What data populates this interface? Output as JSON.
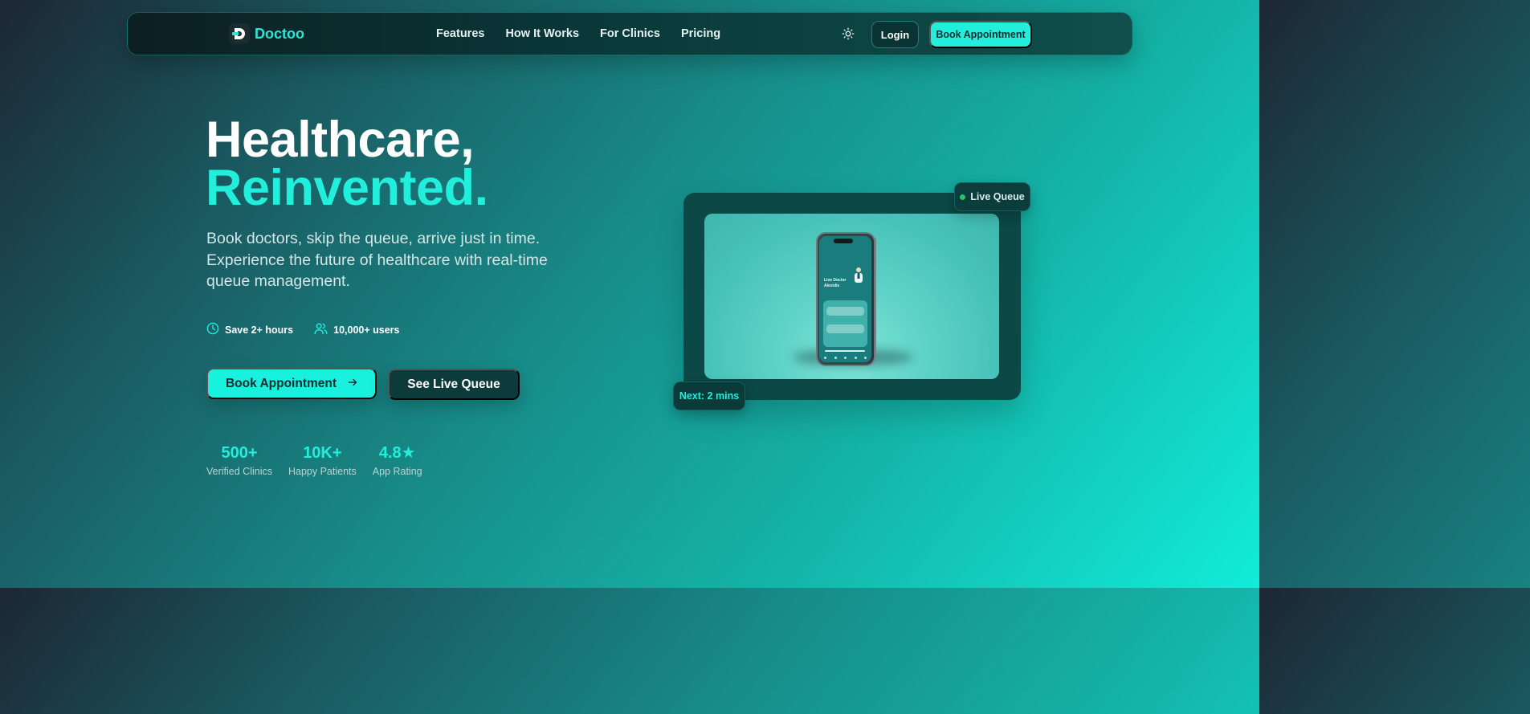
{
  "colors": {
    "accent": "#22eedc",
    "nav_bg": "#0a3a3a",
    "card_bg": "#0b4846",
    "live_dot": "#25c36a"
  },
  "nav": {
    "brand": "Doctoo",
    "links": [
      "Features",
      "How It Works",
      "For Clinics",
      "Pricing"
    ],
    "theme_icon": "sun-icon",
    "login_label": "Login",
    "book_label": "Book Appointment"
  },
  "hero": {
    "title_line1": "Healthcare,",
    "title_line2": "Reinvented.",
    "subtitle": "Book doctors, skip the queue, arrive just in time. Experience the future of healthcare with real-time queue management.",
    "features": [
      {
        "icon": "clock-icon",
        "label": "Save 2+ hours"
      },
      {
        "icon": "users-icon",
        "label": "10,000+ users"
      }
    ],
    "primary_cta": "Book Appointment",
    "secondary_cta": "See Live Queue",
    "stats": [
      {
        "value": "500+",
        "label": "Verified Clinics"
      },
      {
        "value": "10K+",
        "label": "Happy Patients"
      },
      {
        "value": "4.8★",
        "label": "App Rating"
      }
    ]
  },
  "preview": {
    "live_badge": "Live Queue",
    "next_badge": "Next: 2 mins",
    "screen_title_1": "Live Doctor",
    "screen_title_2": "Alexidis"
  }
}
